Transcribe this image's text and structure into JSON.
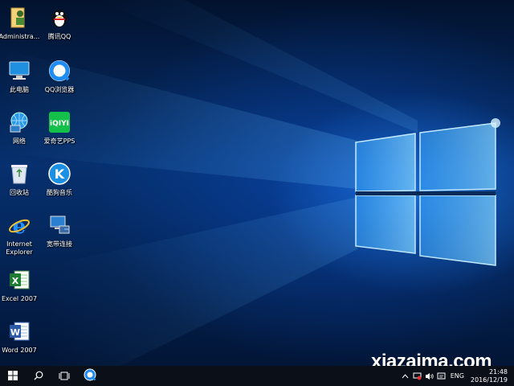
{
  "desktop": {
    "icons": [
      {
        "label": "Administra...",
        "icon": "folder-user-icon"
      },
      {
        "label": "腾讯QQ",
        "icon": "qq-penguin-icon"
      },
      {
        "label": "此电脑",
        "icon": "computer-icon"
      },
      {
        "label": "QQ浏览器",
        "icon": "qq-browser-icon"
      },
      {
        "label": "网络",
        "icon": "network-icon"
      },
      {
        "label": "爱奇艺PPS",
        "icon": "iqiyi-icon"
      },
      {
        "label": "回收站",
        "icon": "recycle-bin-icon"
      },
      {
        "label": "酷狗音乐",
        "icon": "kugou-icon"
      },
      {
        "label": "Internet Explorer",
        "icon": "internet-explorer-icon"
      },
      {
        "label": "宽带连接",
        "icon": "broadband-connection-icon"
      },
      {
        "label": "Excel 2007",
        "icon": "excel-icon"
      },
      {
        "label": "Word 2007",
        "icon": "word-icon"
      }
    ]
  },
  "taskbar": {
    "tray": {
      "language": "ENG",
      "time": "21:48",
      "date": "2016/12/19"
    }
  },
  "watermark": "xiazaima.com",
  "colors": {
    "taskbar": "#0b0f18",
    "accent": "#1e90ff"
  }
}
